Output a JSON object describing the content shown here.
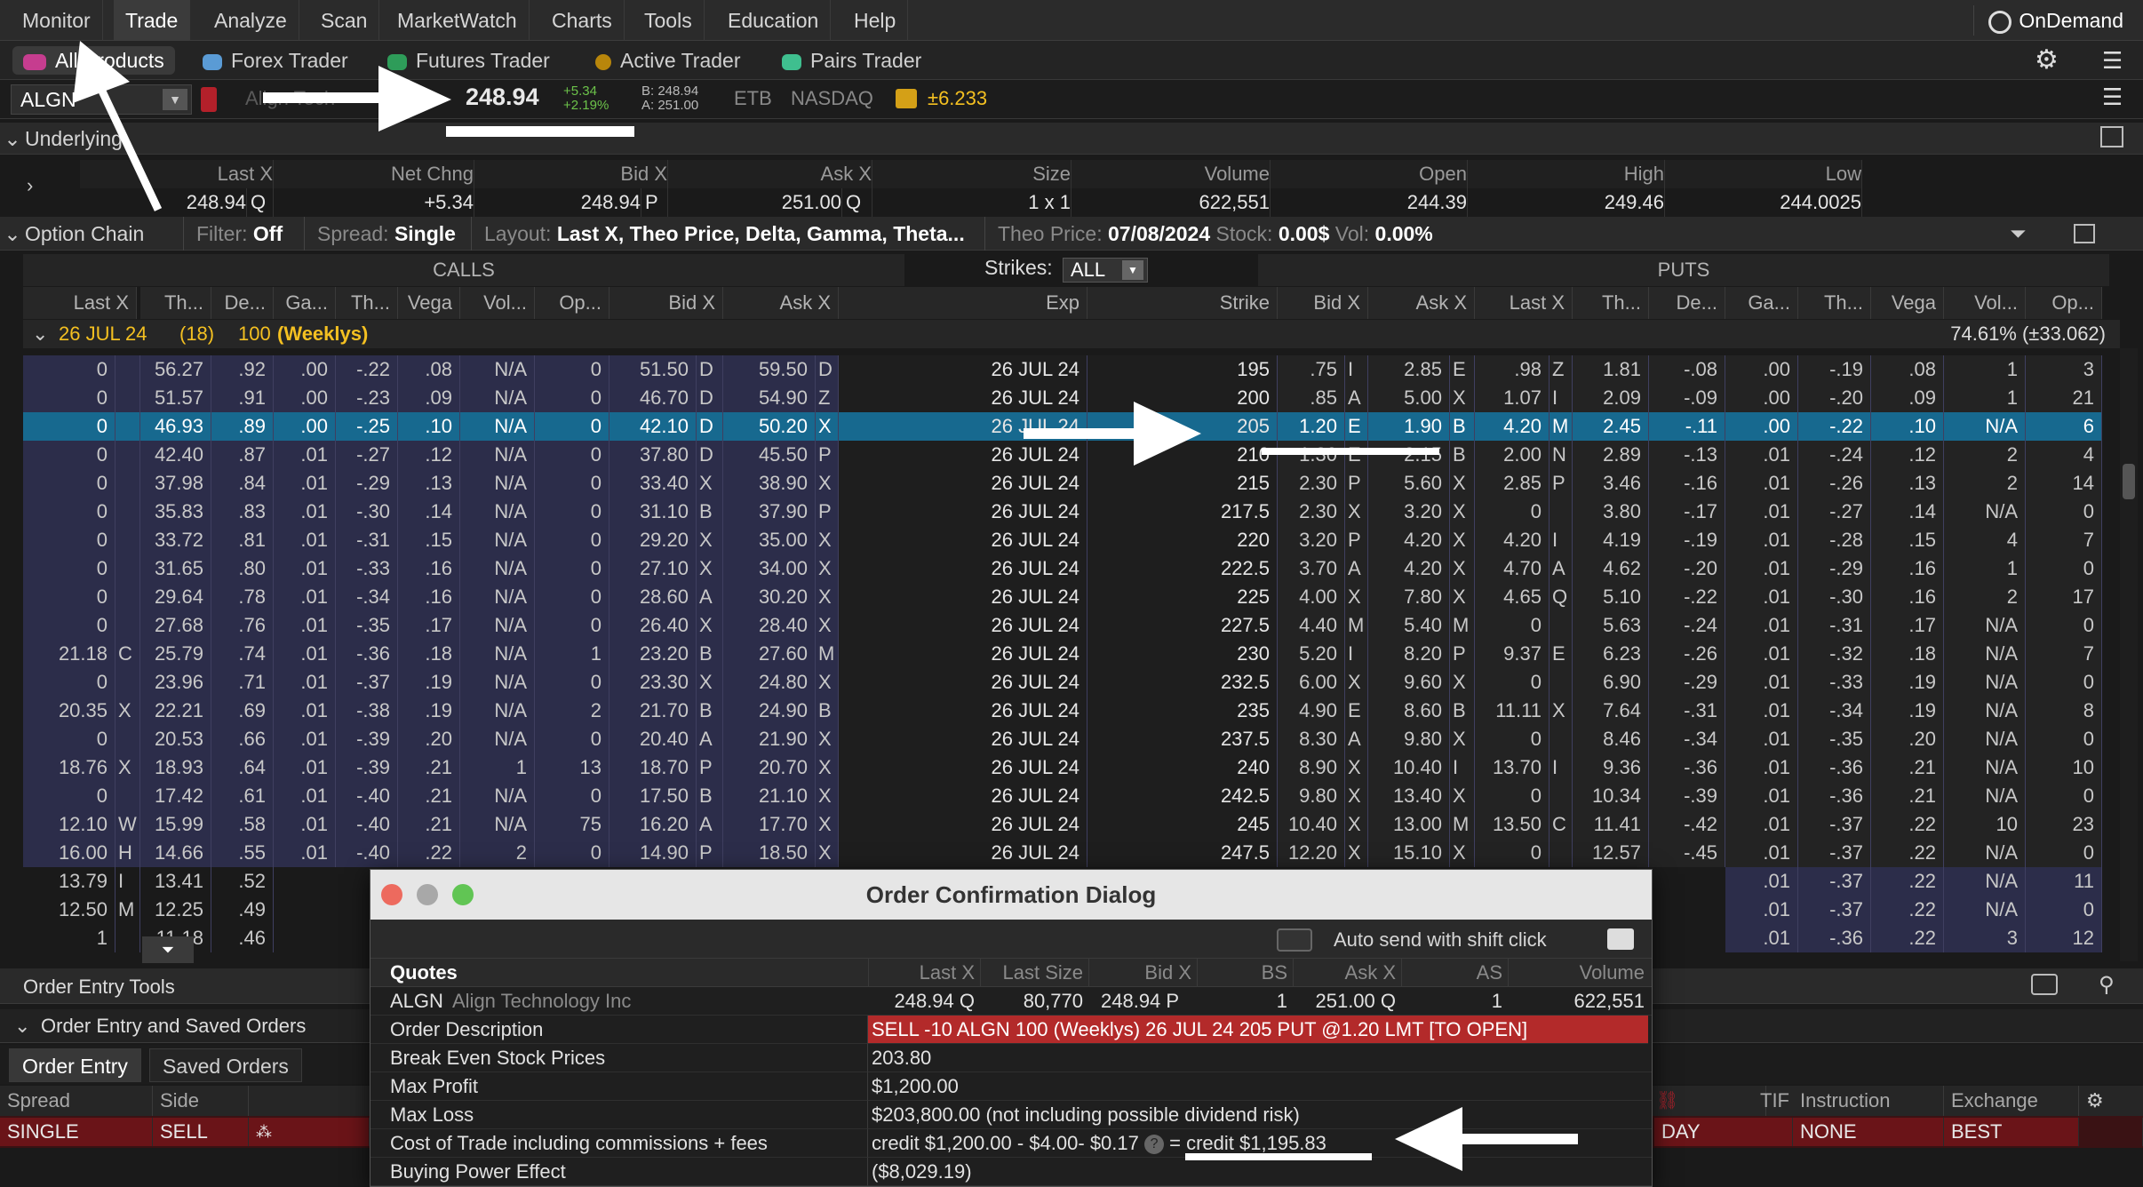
{
  "menu": {
    "items": [
      "Monitor",
      "Trade",
      "Analyze",
      "Scan",
      "MarketWatch",
      "Charts",
      "Tools",
      "Education",
      "Help"
    ],
    "active": "Trade",
    "ondemand": "OnDemand"
  },
  "products": {
    "all": "All Products",
    "forex": "Forex Trader",
    "futures": "Futures Trader",
    "active": "Active Trader",
    "pairs": "Pairs Trader"
  },
  "quote": {
    "symbol": "ALGN",
    "company_faded": "Align Tech",
    "last": "248.94",
    "change": "+5.34",
    "change_pct": "+2.19%",
    "bid": "B: 248.94",
    "ask": "A: 251.00",
    "etb": "ETB",
    "exchange": "NASDAQ",
    "expected_move": "±6.233"
  },
  "underlying": {
    "title": "Underlying",
    "headers": [
      "Last X",
      "Net Chng",
      "Bid X",
      "Ask X",
      "Size",
      "Volume",
      "Open",
      "High",
      "Low"
    ],
    "values": [
      "248.94",
      "Q",
      "+5.34",
      "248.94",
      "P",
      "251.00",
      "Q",
      "1 x 1",
      "622,551",
      "244.39",
      "249.46",
      "244.0025"
    ]
  },
  "chain_bar": {
    "title": "Option Chain",
    "filter_label": "Filter:",
    "filter_value": "Off",
    "spread_label": "Spread:",
    "spread_value": "Single",
    "layout_label": "Layout:",
    "layout_value": "Last X, Theo Price, Delta, Gamma, Theta...",
    "theo_label": "Theo Price:",
    "theo_date": "07/08/2024",
    "stock_label": "Stock:",
    "stock_value": "0.00$",
    "vol_label": "Vol:",
    "vol_value": "0.00%"
  },
  "chain": {
    "calls_label": "CALLS",
    "puts_label": "PUTS",
    "strikes_label": "Strikes:",
    "strikes_value": "ALL",
    "call_headers": [
      "Last X",
      "Th...",
      "De...",
      "Ga...",
      "Th...",
      "Vega",
      "Vol...",
      "Op...",
      "Bid X",
      "Ask X"
    ],
    "mid_headers": [
      "Exp",
      "Strike"
    ],
    "put_headers": [
      "Bid X",
      "Ask X",
      "Last X",
      "Th...",
      "De...",
      "Ga...",
      "Th...",
      "Vega",
      "Vol...",
      "Op..."
    ],
    "series_date": "26 JUL 24",
    "series_days": "(18)",
    "series_mult": "100",
    "series_type": "(Weeklys)",
    "series_iv": "74.61% (±33.062)",
    "rows": [
      [
        "0",
        "",
        "56.27",
        ".92",
        ".00",
        "-.22",
        ".08",
        "N/A",
        "0",
        "51.50",
        "D",
        "59.50",
        "D",
        "26 JUL 24",
        "195",
        ".75",
        "I",
        "2.85",
        "E",
        ".98",
        "Z",
        "1.81",
        "-.08",
        ".00",
        "-.19",
        ".08",
        "1",
        "3"
      ],
      [
        "0",
        "",
        "51.57",
        ".91",
        ".00",
        "-.23",
        ".09",
        "N/A",
        "0",
        "46.70",
        "D",
        "54.90",
        "Z",
        "26 JUL 24",
        "200",
        ".85",
        "A",
        "5.00",
        "X",
        "1.07",
        "I",
        "2.09",
        "-.09",
        ".00",
        "-.20",
        ".09",
        "1",
        "21"
      ],
      [
        "0",
        "",
        "46.93",
        ".89",
        ".00",
        "-.25",
        ".10",
        "N/A",
        "0",
        "42.10",
        "D",
        "50.20",
        "X",
        "26 JUL 24",
        "205",
        "1.20",
        "E",
        "1.90",
        "B",
        "4.20",
        "M",
        "2.45",
        "-.11",
        ".00",
        "-.22",
        ".10",
        "N/A",
        "6"
      ],
      [
        "0",
        "",
        "42.40",
        ".87",
        ".01",
        "-.27",
        ".12",
        "N/A",
        "0",
        "37.80",
        "D",
        "45.50",
        "P",
        "26 JUL 24",
        "210",
        "1.30",
        "E",
        "2.15",
        "B",
        "2.00",
        "N",
        "2.89",
        "-.13",
        ".01",
        "-.24",
        ".12",
        "2",
        "4"
      ],
      [
        "0",
        "",
        "37.98",
        ".84",
        ".01",
        "-.29",
        ".13",
        "N/A",
        "0",
        "33.40",
        "X",
        "38.90",
        "X",
        "26 JUL 24",
        "215",
        "2.30",
        "P",
        "5.60",
        "X",
        "2.85",
        "P",
        "3.46",
        "-.16",
        ".01",
        "-.26",
        ".13",
        "2",
        "14"
      ],
      [
        "0",
        "",
        "35.83",
        ".83",
        ".01",
        "-.30",
        ".14",
        "N/A",
        "0",
        "31.10",
        "B",
        "37.90",
        "P",
        "26 JUL 24",
        "217.5",
        "2.30",
        "X",
        "3.20",
        "X",
        "0",
        "",
        "3.80",
        "-.17",
        ".01",
        "-.27",
        ".14",
        "N/A",
        "0"
      ],
      [
        "0",
        "",
        "33.72",
        ".81",
        ".01",
        "-.31",
        ".15",
        "N/A",
        "0",
        "29.20",
        "X",
        "35.00",
        "X",
        "26 JUL 24",
        "220",
        "3.20",
        "P",
        "4.20",
        "X",
        "4.20",
        "I",
        "4.19",
        "-.19",
        ".01",
        "-.28",
        ".15",
        "4",
        "7"
      ],
      [
        "0",
        "",
        "31.65",
        ".80",
        ".01",
        "-.33",
        ".16",
        "N/A",
        "0",
        "27.10",
        "X",
        "34.00",
        "X",
        "26 JUL 24",
        "222.5",
        "3.70",
        "A",
        "4.20",
        "X",
        "4.70",
        "A",
        "4.62",
        "-.20",
        ".01",
        "-.29",
        ".16",
        "1",
        "0"
      ],
      [
        "0",
        "",
        "29.64",
        ".78",
        ".01",
        "-.34",
        ".16",
        "N/A",
        "0",
        "28.60",
        "A",
        "30.20",
        "X",
        "26 JUL 24",
        "225",
        "4.00",
        "X",
        "7.80",
        "X",
        "4.65",
        "Q",
        "5.10",
        "-.22",
        ".01",
        "-.30",
        ".16",
        "2",
        "17"
      ],
      [
        "0",
        "",
        "27.68",
        ".76",
        ".01",
        "-.35",
        ".17",
        "N/A",
        "0",
        "26.40",
        "X",
        "28.40",
        "X",
        "26 JUL 24",
        "227.5",
        "4.40",
        "M",
        "5.40",
        "M",
        "0",
        "",
        "5.63",
        "-.24",
        ".01",
        "-.31",
        ".17",
        "N/A",
        "0"
      ],
      [
        "21.18",
        "C",
        "25.79",
        ".74",
        ".01",
        "-.36",
        ".18",
        "N/A",
        "1",
        "23.20",
        "B",
        "27.60",
        "M",
        "26 JUL 24",
        "230",
        "5.20",
        "I",
        "8.20",
        "P",
        "9.37",
        "E",
        "6.23",
        "-.26",
        ".01",
        "-.32",
        ".18",
        "N/A",
        "7"
      ],
      [
        "0",
        "",
        "23.96",
        ".71",
        ".01",
        "-.37",
        ".19",
        "N/A",
        "0",
        "23.30",
        "X",
        "24.80",
        "X",
        "26 JUL 24",
        "232.5",
        "6.00",
        "X",
        "9.60",
        "X",
        "0",
        "",
        "6.90",
        "-.29",
        ".01",
        "-.33",
        ".19",
        "N/A",
        "0"
      ],
      [
        "20.35",
        "X",
        "22.21",
        ".69",
        ".01",
        "-.38",
        ".19",
        "N/A",
        "2",
        "21.70",
        "B",
        "24.90",
        "B",
        "26 JUL 24",
        "235",
        "4.90",
        "E",
        "8.60",
        "B",
        "11.11",
        "X",
        "7.64",
        "-.31",
        ".01",
        "-.34",
        ".19",
        "N/A",
        "8"
      ],
      [
        "0",
        "",
        "20.53",
        ".66",
        ".01",
        "-.39",
        ".20",
        "N/A",
        "0",
        "20.40",
        "A",
        "21.90",
        "X",
        "26 JUL 24",
        "237.5",
        "8.30",
        "A",
        "9.80",
        "X",
        "0",
        "",
        "8.46",
        "-.34",
        ".01",
        "-.35",
        ".20",
        "N/A",
        "0"
      ],
      [
        "18.76",
        "X",
        "18.93",
        ".64",
        ".01",
        "-.39",
        ".21",
        "1",
        "13",
        "18.70",
        "P",
        "20.70",
        "X",
        "26 JUL 24",
        "240",
        "8.90",
        "X",
        "10.40",
        "I",
        "13.70",
        "I",
        "9.36",
        "-.36",
        ".01",
        "-.36",
        ".21",
        "N/A",
        "10"
      ],
      [
        "0",
        "",
        "17.42",
        ".61",
        ".01",
        "-.40",
        ".21",
        "N/A",
        "0",
        "17.50",
        "B",
        "21.10",
        "X",
        "26 JUL 24",
        "242.5",
        "9.80",
        "X",
        "13.40",
        "X",
        "0",
        "",
        "10.34",
        "-.39",
        ".01",
        "-.36",
        ".21",
        "N/A",
        "0"
      ],
      [
        "12.10",
        "W",
        "15.99",
        ".58",
        ".01",
        "-.40",
        ".21",
        "N/A",
        "75",
        "16.20",
        "A",
        "17.70",
        "X",
        "26 JUL 24",
        "245",
        "10.40",
        "X",
        "13.00",
        "M",
        "13.50",
        "C",
        "11.41",
        "-.42",
        ".01",
        "-.37",
        ".22",
        "10",
        "23"
      ],
      [
        "16.00",
        "H",
        "14.66",
        ".55",
        ".01",
        "-.40",
        ".22",
        "2",
        "0",
        "14.90",
        "P",
        "18.50",
        "X",
        "26 JUL 24",
        "247.5",
        "12.20",
        "X",
        "15.10",
        "X",
        "0",
        "",
        "12.57",
        "-.45",
        ".01",
        "-.37",
        ".22",
        "N/A",
        "0"
      ],
      [
        "13.79",
        "I",
        "13.41",
        ".52",
        "",
        "",
        "",
        "",
        "",
        "",
        "",
        "",
        "",
        "",
        "",
        "",
        "",
        "",
        "",
        "",
        "",
        "",
        "",
        ".01",
        "-.37",
        ".22",
        "N/A",
        "11"
      ],
      [
        "12.50",
        "M",
        "12.25",
        ".49",
        "",
        "",
        "",
        "",
        "",
        "",
        "",
        "",
        "",
        "",
        "",
        "",
        "",
        "",
        "",
        "",
        "",
        "",
        "",
        ".01",
        "-.37",
        ".22",
        "N/A",
        "0"
      ],
      [
        "1",
        "",
        "11.18",
        ".46",
        "",
        "",
        "",
        "",
        "",
        "",
        "",
        "",
        "",
        "",
        "",
        "",
        "",
        "",
        "",
        "",
        "",
        "",
        "",
        ".01",
        "-.36",
        ".22",
        "3",
        "12"
      ]
    ]
  },
  "order_entry": {
    "tools": "Order Entry Tools",
    "saved": "Order Entry and Saved Orders",
    "tab_entry": "Order Entry",
    "tab_saved": "Saved Orders",
    "hdr_spread": "Spread",
    "hdr_side": "Side",
    "hdr_tif": "TIF",
    "hdr_instruction": "Instruction",
    "hdr_exchange": "Exchange",
    "val_spread": "SINGLE",
    "val_side": "SELL",
    "val_tif": "DAY",
    "val_instruction": "NONE",
    "val_exchange": "BEST"
  },
  "dialog": {
    "title": "Order Confirmation Dialog",
    "auto_send": "Auto send with shift click",
    "quotes_label": "Quotes",
    "quote_headers": [
      "Last X",
      "Last Size",
      "Bid X",
      "BS",
      "Ask X",
      "AS",
      "Volume"
    ],
    "symbol": "ALGN",
    "company": "Align Technology Inc",
    "q_last": "248.94 Q",
    "q_lastsize": "80,770",
    "q_bid": "248.94 P",
    "q_bs": "1",
    "q_ask": "251.00 Q",
    "q_as": "1",
    "q_volume": "622,551",
    "desc_label": "Order Description",
    "desc_value": "SELL -10 ALGN 100 (Weeklys) 26 JUL 24 205 PUT @1.20 LMT [TO OPEN]",
    "be_label": "Break Even Stock Prices",
    "be_value": "203.80",
    "mp_label": "Max Profit",
    "mp_value": "$1,200.00",
    "ml_label": "Max Loss",
    "ml_value": "$203,800.00 (not including possible dividend risk)",
    "cost_label": "Cost of Trade including commissions + fees",
    "cost_value": "credit $1,200.00 - $4.00- $0.17",
    "cost_total": "= credit $1,195.83",
    "bp_label": "Buying Power Effect",
    "bp_value": "($8,029.19)"
  },
  "colors": {
    "call_bg": "#2c2d4a",
    "highlight": "#17698f",
    "sell_red": "#6a1418",
    "gain_green": "#6cc24a"
  }
}
